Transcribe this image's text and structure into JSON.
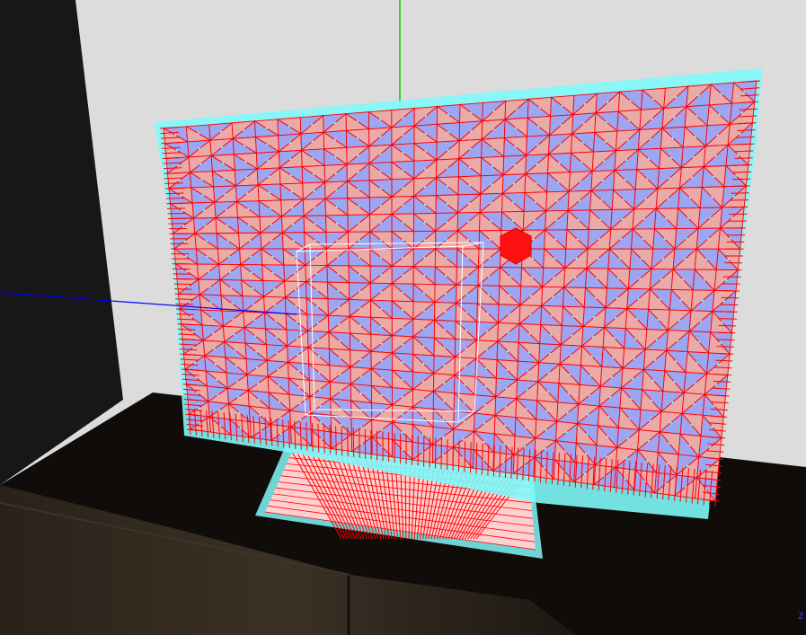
{
  "scene": {
    "corner_axis_label": "z",
    "colors": {
      "background_wall": "#dcdcdc",
      "wall_shadow": "#171717",
      "cabinet_top": "#0f0c09",
      "cabinet_front": "#2c241c",
      "mesh_fill_light": "#e9aaa8",
      "mesh_fill_blue": "#9ea6f2",
      "wireframe": "#ff0000",
      "vertex_normals": "#7ff8fa",
      "bounding_box": "#ffffff",
      "axis_y": "#00d000",
      "axis_x": "#0000ff",
      "light_marker": "#ff0000"
    },
    "objects": [
      {
        "name": "tv-screen-mesh",
        "kind": "triangle-mesh"
      },
      {
        "name": "tv-stand-mesh",
        "kind": "triangle-mesh"
      },
      {
        "name": "selection-bounding-box",
        "kind": "wire-box"
      },
      {
        "name": "light-marker",
        "kind": "hexagon"
      }
    ]
  }
}
